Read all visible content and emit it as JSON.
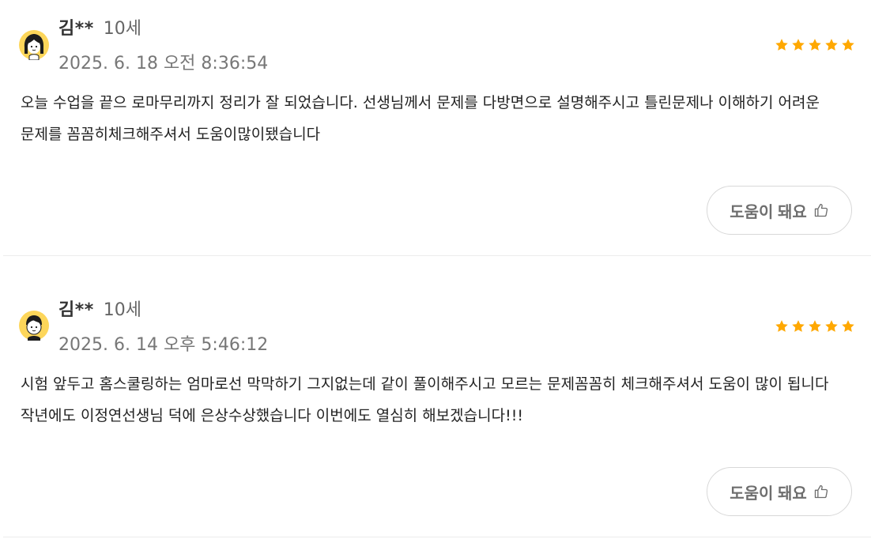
{
  "reviews": [
    {
      "avatar_icon": "girl-avatar-icon",
      "name": "김**",
      "age": "10세",
      "date": "2025. 6. 18 오전 8:36:54",
      "rating": 5,
      "text": "오늘 수업을 끝으 로마무리까지 정리가 잘 되었습니다. 선생님께서 문제를 다방면으로 설명해주시고 틀린문제나 이해하기 어려운 문제를 꼼꼼히체크해주셔서 도움이많이됐습니다",
      "helpful_label": "도움이 돼요"
    },
    {
      "avatar_icon": "boy-avatar-icon",
      "name": "김**",
      "age": "10세",
      "date": "2025. 6. 14 오후 5:46:12",
      "rating": 5,
      "text": "시험 앞두고 홈스쿨링하는 엄마로선 막막하기 그지없는데 같이 풀이해주시고 모르는 문제꼼꼼히 체크해주셔서 도움이 많이 됩니다 작년에도 이정연선생님 덕에 은상수상했습니다 이번에도 열심히 해보겠습니다!!!",
      "helpful_label": "도움이 돼요"
    }
  ],
  "colors": {
    "star": "#FFA800",
    "avatar_bg": "#FDD65A",
    "text": "#222222",
    "muted": "#777777"
  }
}
